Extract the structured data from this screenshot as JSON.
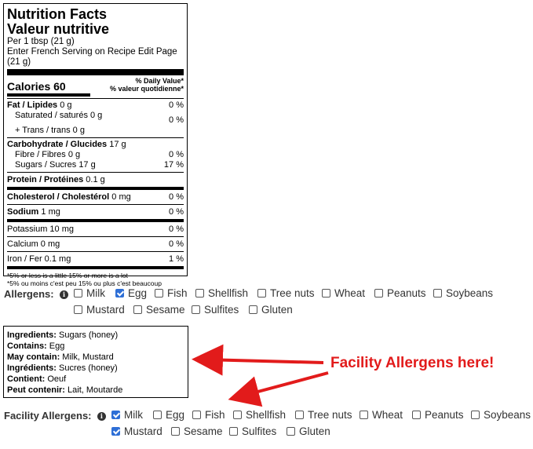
{
  "nutrition": {
    "title_en": "Nutrition Facts",
    "title_fr": "Valeur nutritive",
    "per": "Per 1 tbsp (21 g)",
    "fr_serving": "Enter French Serving on Recipe Edit Page",
    "fr_serving2": "(21 g)",
    "calories_label": "Calories 60",
    "dv_en": "% Daily Value*",
    "dv_fr": "% valeur quotidienne*",
    "rows": {
      "fat": {
        "label": "Fat / Lipides",
        "amt": "0 g",
        "pct": "0 %"
      },
      "sat": {
        "label": "Saturated / saturés 0 g",
        "pct": "0 %"
      },
      "trans": {
        "label": "+ Trans / trans 0 g"
      },
      "carb": {
        "label": "Carbohydrate / Glucides",
        "amt": "17 g"
      },
      "fibre": {
        "label": "Fibre / Fibres 0 g",
        "pct": "0 %"
      },
      "sugars": {
        "label": "Sugars / Sucres 17 g",
        "pct": "17 %"
      },
      "protein": {
        "label": "Protein / Protéines",
        "amt": "0.1 g"
      },
      "chol": {
        "label": "Cholesterol / Cholestérol",
        "amt": "0 mg",
        "pct": "0 %"
      },
      "sodium": {
        "label": "Sodium",
        "amt": "1 mg",
        "pct": "0 %"
      },
      "potassium": {
        "label": "Potassium 10 mg",
        "pct": "0 %"
      },
      "calcium": {
        "label": "Calcium 0 mg",
        "pct": "0 %"
      },
      "iron": {
        "label": "Iron / Fer 0.1 mg",
        "pct": "1 %"
      }
    },
    "foot_en": "*5% or less is a little 15% or more is a lot",
    "foot_fr": "*5% ou moins c'est peu 15% ou plus c'est beaucoup"
  },
  "allergens": {
    "label": "Allergens:",
    "items": [
      "Milk",
      "Egg",
      "Fish",
      "Shellfish",
      "Tree nuts",
      "Wheat",
      "Peanuts",
      "Soybeans",
      "Mustard",
      "Sesame",
      "Sulfites",
      "Gluten"
    ],
    "checked": [
      "Egg"
    ]
  },
  "contains_box": {
    "ingredients_label": "Ingredients:",
    "ingredients": "Sugars (honey)",
    "contains_label": "Contains:",
    "contains": "Egg",
    "may_label": "May contain:",
    "may": "Milk, Mustard",
    "ingr_fr_label": "Ingrédients:",
    "ingr_fr": "Sucres (honey)",
    "contient_label": "Contient:",
    "contient": "Oeuf",
    "peut_label": "Peut contenir:",
    "peut": "Lait, Moutarde"
  },
  "facility": {
    "label": "Facility Allergens:",
    "items": [
      "Milk",
      "Egg",
      "Fish",
      "Shellfish",
      "Tree nuts",
      "Wheat",
      "Peanuts",
      "Soybeans",
      "Mustard",
      "Sesame",
      "Sulfites",
      "Gluten"
    ],
    "checked": [
      "Milk",
      "Mustard"
    ]
  },
  "callout": {
    "text": "Facility Allergens here!",
    "color": "#e21b1b"
  },
  "accent": "#2e6fd6"
}
